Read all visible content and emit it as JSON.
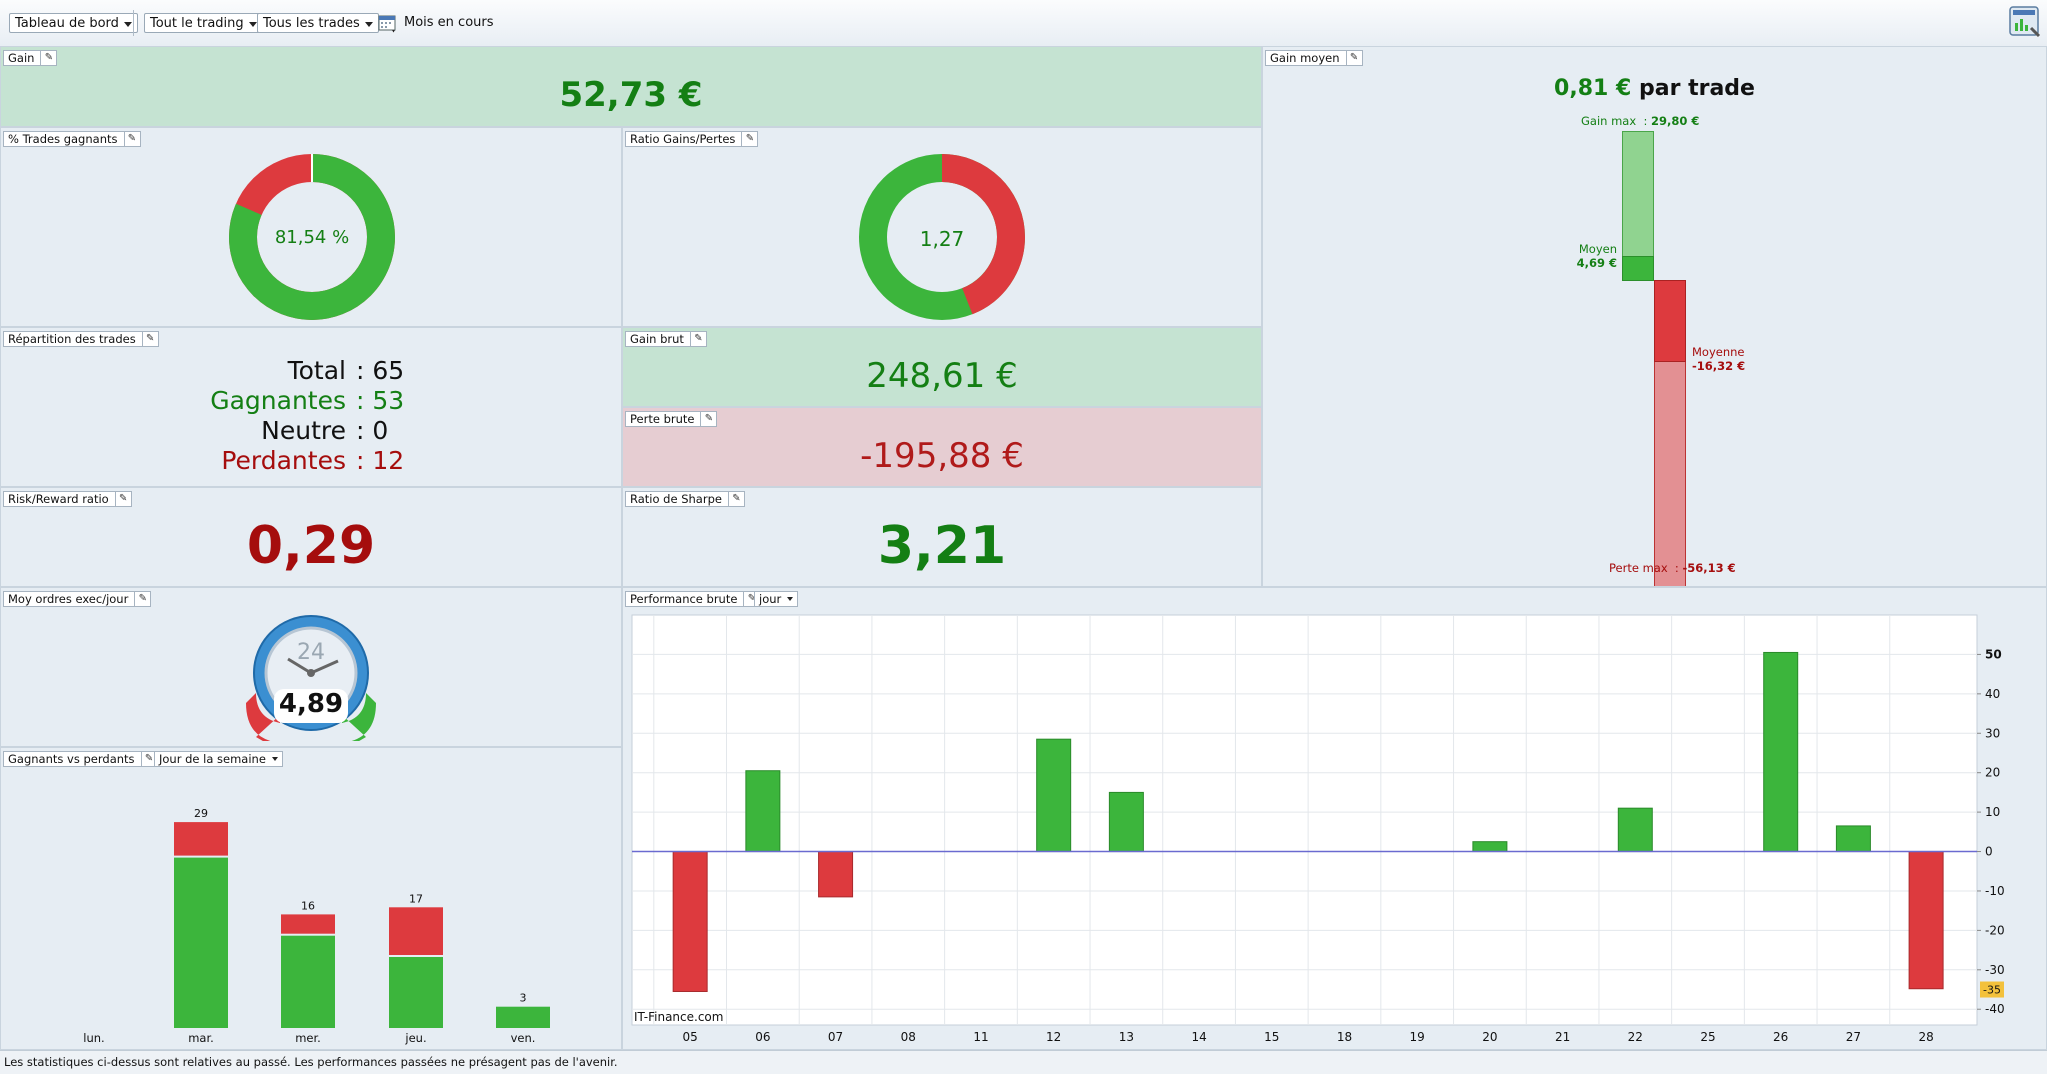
{
  "toolbar": {
    "dashboard": "Tableau de bord",
    "trading": "Tout le trading",
    "trades": "Tous les trades",
    "period": "Mois en cours"
  },
  "gain": {
    "title": "Gain",
    "value": "52,73 €"
  },
  "win_pct": {
    "title": "% Trades gagnants",
    "label": "81,54 %",
    "fraction": 0.8154
  },
  "ratio": {
    "title": "Ratio Gains/Pertes",
    "label": "1,27",
    "fraction": 0.44
  },
  "distribution": {
    "title": "Répartition des trades",
    "rows": [
      {
        "label": "Total",
        "value": ": 65"
      },
      {
        "label": "Gagnantes",
        "value": ": 53"
      },
      {
        "label": "Neutre",
        "value": ": 0"
      },
      {
        "label": "Perdantes",
        "value": ": 12"
      }
    ]
  },
  "gross_gain": {
    "title": "Gain brut",
    "value": "248,61 €"
  },
  "gross_loss": {
    "title": "Perte brute",
    "value": "-195,88 €"
  },
  "risk_reward": {
    "title": "Risk/Reward ratio",
    "value": "0,29"
  },
  "sharpe": {
    "title": "Ratio de Sharpe",
    "value": "3,21"
  },
  "avg_gain": {
    "title": "Gain moyen",
    "value": "0,81 €",
    "suffix": "par trade",
    "gain_max_label": "Gain max",
    "gain_max": "29,80 €",
    "gain_avg_label": "Moyen",
    "gain_avg": "4,69 €",
    "loss_avg_label": "Moyenne",
    "loss_avg": "-16,32 €",
    "loss_max_label": "Perte max",
    "loss_max": "-56,13 €"
  },
  "orders": {
    "title": "Moy ordres exec/jour",
    "value": "4,89",
    "clock_num": "24"
  },
  "winners_losers": {
    "title": "Gagnants vs perdants",
    "mode": "Jour de la semaine"
  },
  "performance": {
    "title": "Performance brute",
    "mode": "jour",
    "watermark": "IT-Finance.com",
    "current_marker": "-35"
  },
  "colors": {
    "green": "#3cb53c",
    "red": "#dd3a3e",
    "dark_green": "#147f14",
    "dark_red": "#a50d0d"
  },
  "chart_data": [
    {
      "type": "bar",
      "categories": [
        "05",
        "06",
        "07",
        "08",
        "11",
        "12",
        "13",
        "14",
        "15",
        "18",
        "19",
        "20",
        "21",
        "22",
        "25",
        "26",
        "27",
        "28"
      ],
      "values": [
        -35.5,
        20.5,
        -11.5,
        0,
        0,
        28.5,
        15,
        0,
        0,
        0,
        0,
        2.5,
        0,
        11,
        0,
        50.5,
        6.5,
        -34.8
      ],
      "yticks": [
        50,
        40,
        30,
        20,
        10,
        0,
        -10,
        -20,
        -30,
        -40
      ],
      "ylim": [
        -44,
        60
      ]
    },
    {
      "type": "bar",
      "categories": [
        "lun.",
        "mar.",
        "mer.",
        "jeu.",
        "ven."
      ],
      "series": [
        {
          "values": [
            0,
            24,
            13,
            10,
            3
          ]
        },
        {
          "values": [
            0,
            5,
            3,
            7,
            0
          ]
        }
      ],
      "totals": [
        "",
        "29",
        "16",
        "17",
        "3"
      ]
    }
  ]
}
